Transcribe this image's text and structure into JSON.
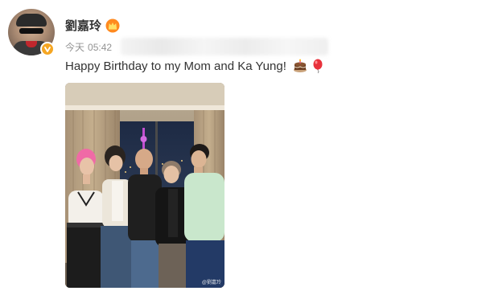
{
  "post": {
    "username": "劉嘉玲",
    "date_label": "今天",
    "time": "05:42",
    "text": "Happy Birthday to my Mom and Ka Yung!",
    "emojis": [
      "birthday-cake-icon",
      "balloon-icon"
    ],
    "photo_watermark": "@劉嘉玲"
  },
  "colors": {
    "username": "#333333",
    "meta": "#939393",
    "verified_badge": "#f5a623",
    "text": "#333333"
  }
}
